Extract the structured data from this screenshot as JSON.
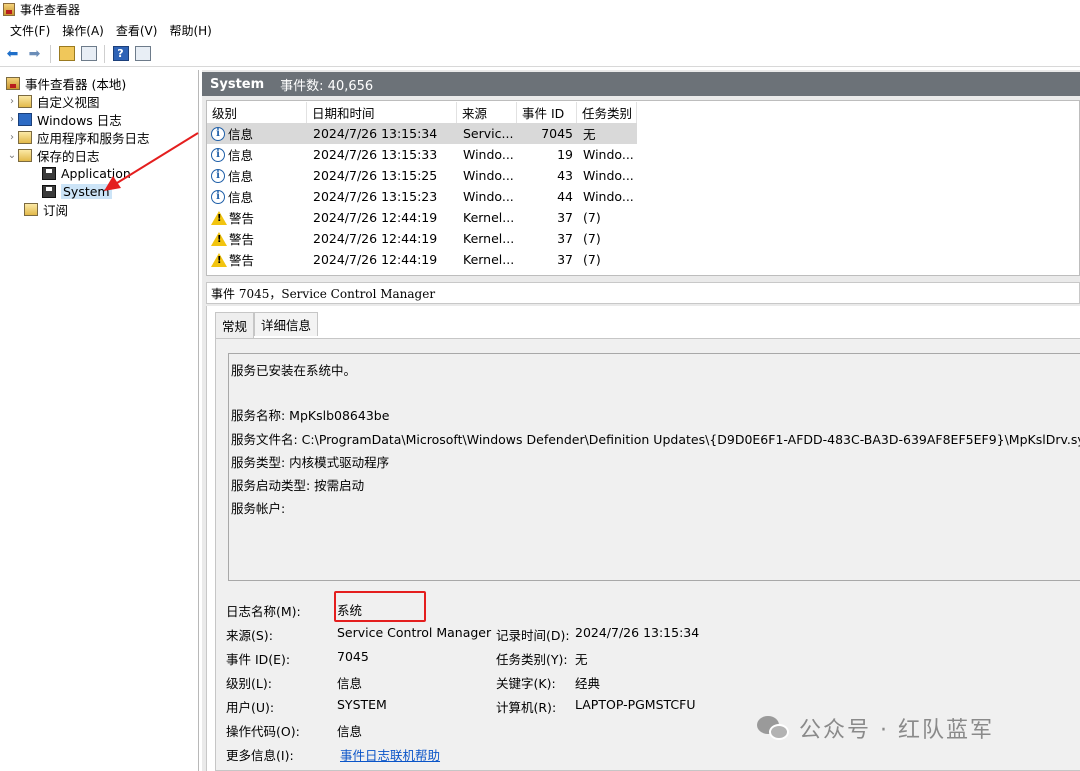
{
  "window": {
    "title": "事件查看器"
  },
  "menu": [
    "文件(F)",
    "操作(A)",
    "查看(V)",
    "帮助(H)"
  ],
  "tree": {
    "root": "事件查看器 (本地)",
    "items": [
      {
        "label": "自定义视图",
        "level": 1,
        "chevron": "›"
      },
      {
        "label": "Windows 日志",
        "level": 1,
        "chevron": "›"
      },
      {
        "label": "应用程序和服务日志",
        "level": 1,
        "chevron": "›"
      },
      {
        "label": "保存的日志",
        "level": 1,
        "chevron": "⌄"
      },
      {
        "label": "Application",
        "level": 2
      },
      {
        "label": "System",
        "level": 2,
        "selected": true
      },
      {
        "label": "订阅",
        "level": 1
      }
    ]
  },
  "log_header": {
    "name": "System",
    "count": "事件数: 40,656"
  },
  "grid": {
    "columns": [
      "级别",
      "日期和时间",
      "来源",
      "事件 ID",
      "任务类别"
    ],
    "rows": [
      {
        "level": "信息",
        "type": "info",
        "datetime": "2024/7/26 13:15:34",
        "source": "Servic...",
        "id": "7045",
        "category": "无",
        "selected": true
      },
      {
        "level": "信息",
        "type": "info",
        "datetime": "2024/7/26 13:15:33",
        "source": "Windo...",
        "id": "19",
        "category": "Windo..."
      },
      {
        "level": "信息",
        "type": "info",
        "datetime": "2024/7/26 13:15:25",
        "source": "Windo...",
        "id": "43",
        "category": "Windo..."
      },
      {
        "level": "信息",
        "type": "info",
        "datetime": "2024/7/26 13:15:23",
        "source": "Windo...",
        "id": "44",
        "category": "Windo..."
      },
      {
        "level": "警告",
        "type": "warn",
        "datetime": "2024/7/26 12:44:19",
        "source": "Kernel...",
        "id": "37",
        "category": "(7)"
      },
      {
        "level": "警告",
        "type": "warn",
        "datetime": "2024/7/26 12:44:19",
        "source": "Kernel...",
        "id": "37",
        "category": "(7)"
      },
      {
        "level": "警告",
        "type": "warn",
        "datetime": "2024/7/26 12:44:19",
        "source": "Kernel...",
        "id": "37",
        "category": "(7)"
      }
    ]
  },
  "detail": {
    "title": "事件 7045，Service Control Manager",
    "tabs": [
      "常规",
      "详细信息"
    ],
    "message": [
      "服务已安装在系统中。",
      "服务名称: MpKslb08643be",
      "服务文件名: C:\\ProgramData\\Microsoft\\Windows Defender\\Definition Updates\\{D9D0E6F1-AFDD-483C-BA3D-639AF8EF5EF9}\\MpKslDrv.sys",
      "服务类型: 内核模式驱动程序",
      "服务启动类型: 按需启动",
      "服务帐户:"
    ],
    "fields": {
      "log_name_label": "日志名称(M):",
      "log_name": "系统",
      "source_label": "来源(S):",
      "source": "Service Control Manager",
      "logged_label": "记录时间(D):",
      "logged": "2024/7/26 13:15:34",
      "event_id_label": "事件 ID(E):",
      "event_id": "7045",
      "task_label": "任务类别(Y):",
      "task": "无",
      "level_label": "级别(L):",
      "level": "信息",
      "keywords_label": "关键字(K):",
      "keywords": "经典",
      "user_label": "用户(U):",
      "user": "SYSTEM",
      "computer_label": "计算机(R):",
      "computer": "LAPTOP-PGMSTCFU",
      "opcode_label": "操作代码(O):",
      "opcode": "信息",
      "more_label": "更多信息(I):",
      "more_link": "事件日志联机帮助"
    }
  },
  "watermark": "公众号 · 红队蓝军",
  "colors": {
    "selection": "#cce4f7",
    "header_strip": "#6c7278",
    "highlight_box": "#e41e1e",
    "link": "#0b55c8"
  }
}
